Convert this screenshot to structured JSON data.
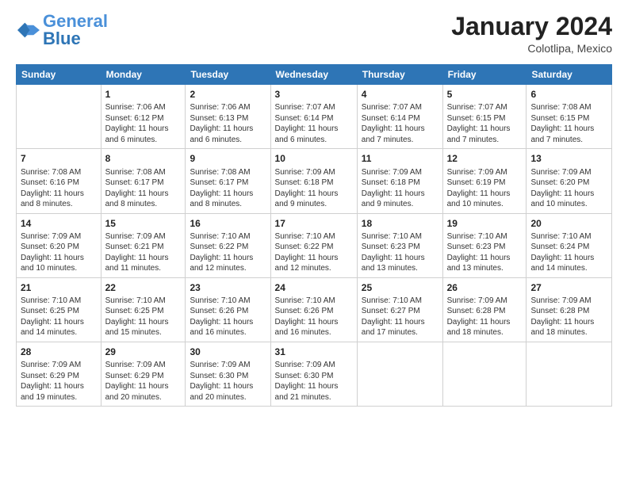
{
  "logo": {
    "text_general": "General",
    "text_blue": "Blue"
  },
  "header": {
    "title": "January 2024",
    "subtitle": "Colotlipa, Mexico"
  },
  "days_of_week": [
    "Sunday",
    "Monday",
    "Tuesday",
    "Wednesday",
    "Thursday",
    "Friday",
    "Saturday"
  ],
  "weeks": [
    [
      {
        "day": "",
        "info": ""
      },
      {
        "day": "1",
        "info": "Sunrise: 7:06 AM\nSunset: 6:12 PM\nDaylight: 11 hours\nand 6 minutes."
      },
      {
        "day": "2",
        "info": "Sunrise: 7:06 AM\nSunset: 6:13 PM\nDaylight: 11 hours\nand 6 minutes."
      },
      {
        "day": "3",
        "info": "Sunrise: 7:07 AM\nSunset: 6:14 PM\nDaylight: 11 hours\nand 6 minutes."
      },
      {
        "day": "4",
        "info": "Sunrise: 7:07 AM\nSunset: 6:14 PM\nDaylight: 11 hours\nand 7 minutes."
      },
      {
        "day": "5",
        "info": "Sunrise: 7:07 AM\nSunset: 6:15 PM\nDaylight: 11 hours\nand 7 minutes."
      },
      {
        "day": "6",
        "info": "Sunrise: 7:08 AM\nSunset: 6:15 PM\nDaylight: 11 hours\nand 7 minutes."
      }
    ],
    [
      {
        "day": "7",
        "info": "Sunrise: 7:08 AM\nSunset: 6:16 PM\nDaylight: 11 hours\nand 8 minutes."
      },
      {
        "day": "8",
        "info": "Sunrise: 7:08 AM\nSunset: 6:17 PM\nDaylight: 11 hours\nand 8 minutes."
      },
      {
        "day": "9",
        "info": "Sunrise: 7:08 AM\nSunset: 6:17 PM\nDaylight: 11 hours\nand 8 minutes."
      },
      {
        "day": "10",
        "info": "Sunrise: 7:09 AM\nSunset: 6:18 PM\nDaylight: 11 hours\nand 9 minutes."
      },
      {
        "day": "11",
        "info": "Sunrise: 7:09 AM\nSunset: 6:18 PM\nDaylight: 11 hours\nand 9 minutes."
      },
      {
        "day": "12",
        "info": "Sunrise: 7:09 AM\nSunset: 6:19 PM\nDaylight: 11 hours\nand 10 minutes."
      },
      {
        "day": "13",
        "info": "Sunrise: 7:09 AM\nSunset: 6:20 PM\nDaylight: 11 hours\nand 10 minutes."
      }
    ],
    [
      {
        "day": "14",
        "info": "Sunrise: 7:09 AM\nSunset: 6:20 PM\nDaylight: 11 hours\nand 10 minutes."
      },
      {
        "day": "15",
        "info": "Sunrise: 7:09 AM\nSunset: 6:21 PM\nDaylight: 11 hours\nand 11 minutes."
      },
      {
        "day": "16",
        "info": "Sunrise: 7:10 AM\nSunset: 6:22 PM\nDaylight: 11 hours\nand 12 minutes."
      },
      {
        "day": "17",
        "info": "Sunrise: 7:10 AM\nSunset: 6:22 PM\nDaylight: 11 hours\nand 12 minutes."
      },
      {
        "day": "18",
        "info": "Sunrise: 7:10 AM\nSunset: 6:23 PM\nDaylight: 11 hours\nand 13 minutes."
      },
      {
        "day": "19",
        "info": "Sunrise: 7:10 AM\nSunset: 6:23 PM\nDaylight: 11 hours\nand 13 minutes."
      },
      {
        "day": "20",
        "info": "Sunrise: 7:10 AM\nSunset: 6:24 PM\nDaylight: 11 hours\nand 14 minutes."
      }
    ],
    [
      {
        "day": "21",
        "info": "Sunrise: 7:10 AM\nSunset: 6:25 PM\nDaylight: 11 hours\nand 14 minutes."
      },
      {
        "day": "22",
        "info": "Sunrise: 7:10 AM\nSunset: 6:25 PM\nDaylight: 11 hours\nand 15 minutes."
      },
      {
        "day": "23",
        "info": "Sunrise: 7:10 AM\nSunset: 6:26 PM\nDaylight: 11 hours\nand 16 minutes."
      },
      {
        "day": "24",
        "info": "Sunrise: 7:10 AM\nSunset: 6:26 PM\nDaylight: 11 hours\nand 16 minutes."
      },
      {
        "day": "25",
        "info": "Sunrise: 7:10 AM\nSunset: 6:27 PM\nDaylight: 11 hours\nand 17 minutes."
      },
      {
        "day": "26",
        "info": "Sunrise: 7:09 AM\nSunset: 6:28 PM\nDaylight: 11 hours\nand 18 minutes."
      },
      {
        "day": "27",
        "info": "Sunrise: 7:09 AM\nSunset: 6:28 PM\nDaylight: 11 hours\nand 18 minutes."
      }
    ],
    [
      {
        "day": "28",
        "info": "Sunrise: 7:09 AM\nSunset: 6:29 PM\nDaylight: 11 hours\nand 19 minutes."
      },
      {
        "day": "29",
        "info": "Sunrise: 7:09 AM\nSunset: 6:29 PM\nDaylight: 11 hours\nand 20 minutes."
      },
      {
        "day": "30",
        "info": "Sunrise: 7:09 AM\nSunset: 6:30 PM\nDaylight: 11 hours\nand 20 minutes."
      },
      {
        "day": "31",
        "info": "Sunrise: 7:09 AM\nSunset: 6:30 PM\nDaylight: 11 hours\nand 21 minutes."
      },
      {
        "day": "",
        "info": ""
      },
      {
        "day": "",
        "info": ""
      },
      {
        "day": "",
        "info": ""
      }
    ]
  ]
}
